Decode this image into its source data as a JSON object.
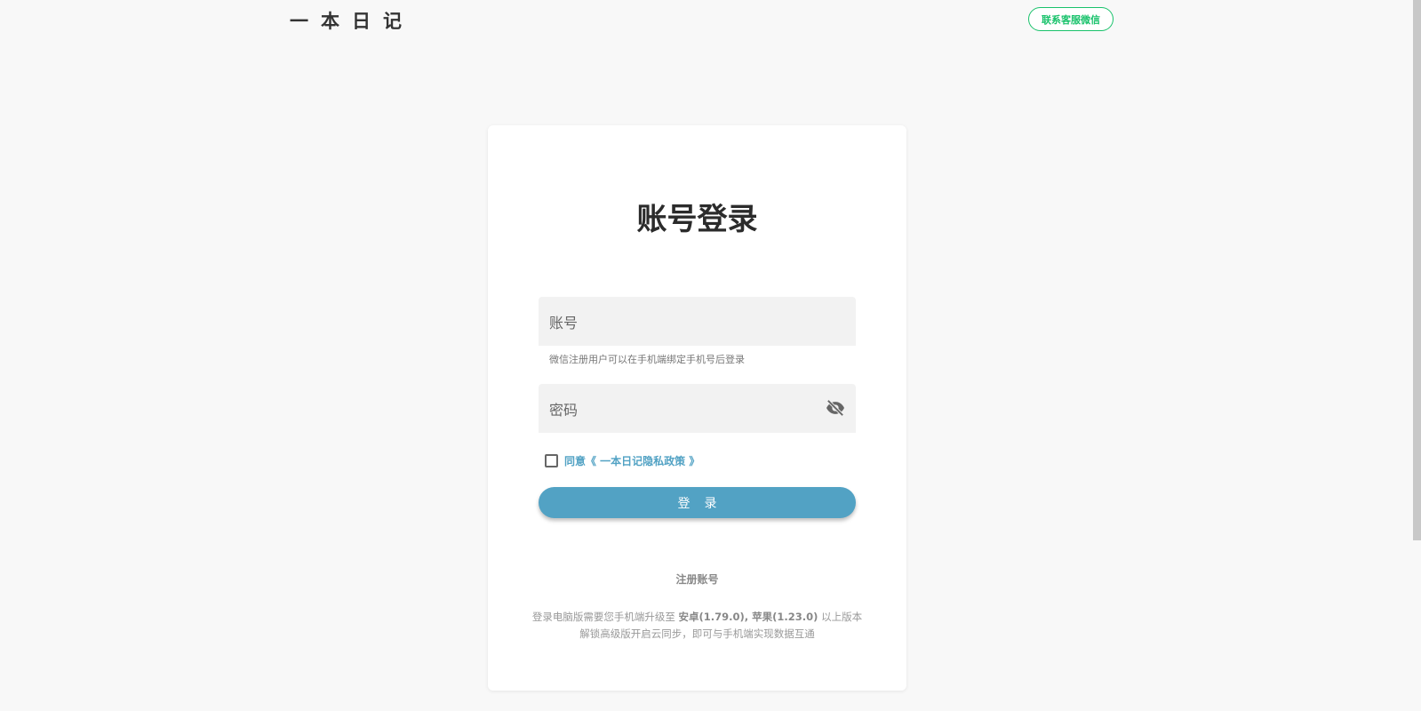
{
  "header": {
    "logo": "一本日记",
    "contact": "联系客服微信"
  },
  "card": {
    "title": "账号登录",
    "account_placeholder": "账号",
    "account_hint": "微信注册用户可以在手机端绑定手机号后登录",
    "password_placeholder": "密码",
    "agree": "同意《 一本日记隐私政策 》",
    "login": "登录",
    "register": "注册账号",
    "note1a": "登录电脑版需要您手机端升级至 ",
    "note1b": "安卓(1.79.0), 苹果(1.23.0)",
    "note1c": " 以上版本",
    "note2": "解锁高级版开启云同步，即可与手机端实现数据互通"
  },
  "colors": {
    "accent": "#52a2c4",
    "green": "#19c26b"
  }
}
